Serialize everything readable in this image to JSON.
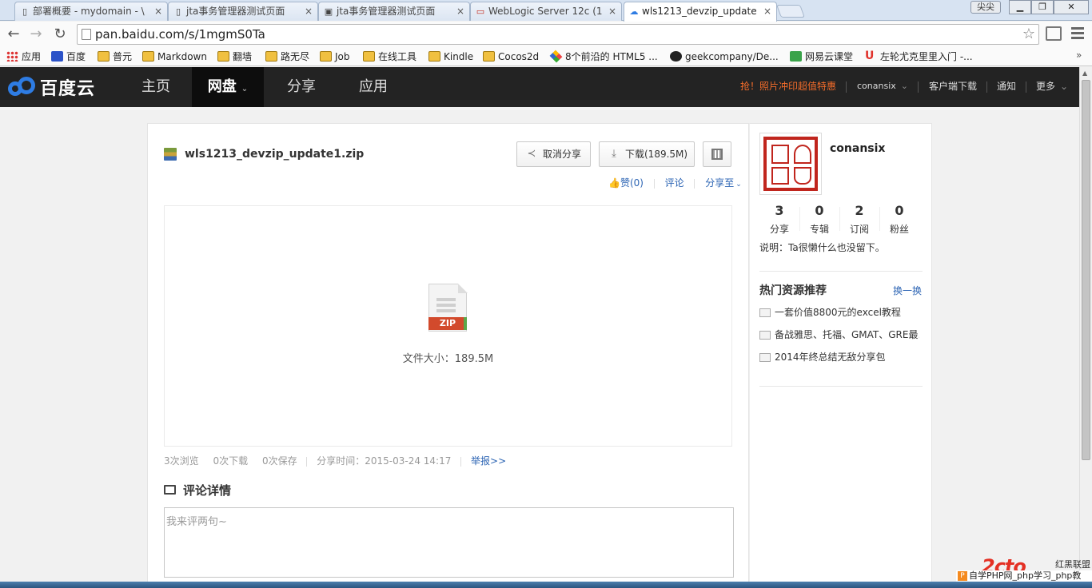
{
  "browser": {
    "tabs": [
      {
        "title": "部署概要 - mydomain - \\",
        "icon": "page-icon"
      },
      {
        "title": "jta事务管理器测试页面",
        "icon": "page-icon"
      },
      {
        "title": "jta事务管理器测试页面",
        "icon": "image-icon"
      },
      {
        "title": "WebLogic Server 12c (1",
        "icon": "oracle-icon"
      },
      {
        "title": "wls1213_devzip_update",
        "icon": "baidu-icon"
      }
    ],
    "user_button": "尖尖",
    "url": "pan.baidu.com/s/1mgmS0Ta",
    "bookmarks": [
      "应用",
      "百度",
      "普元",
      "Markdown",
      "翻墙",
      "路无尽",
      "Job",
      "在线工具",
      "Kindle",
      "Cocos2d",
      "8个前沿的 HTML5 ...",
      "geekcompany/De...",
      "网易云课堂",
      "左轮尤克里里入门 -..."
    ],
    "bookmarks_more": "»"
  },
  "header": {
    "logo_text": "百度云",
    "nav": [
      "主页",
      "网盘",
      "分享",
      "应用"
    ],
    "promo": "抢！照片冲印超值特惠",
    "user": "conansix",
    "client_download": "客户端下载",
    "notify": "通知",
    "more": "更多"
  },
  "file": {
    "name": "wls1213_devzip_update1.zip",
    "cancel_share": "取消分享",
    "download": "下载(189.5M)",
    "like": "赞(0)",
    "comment": "评论",
    "share_to": "分享至",
    "preview_tag": "ZIP",
    "size_label": "文件大小：189.5M",
    "views": "3次浏览",
    "downloads": "0次下载",
    "saves": "0次保存",
    "share_time": "分享时间：2015-03-24 14:17",
    "report": "举报>>"
  },
  "comments": {
    "title": "评论详情",
    "placeholder": "我来评两句~"
  },
  "sidebar": {
    "username": "conansix",
    "stats": [
      {
        "num": "3",
        "label": "分享"
      },
      {
        "num": "0",
        "label": "专辑"
      },
      {
        "num": "2",
        "label": "订阅"
      },
      {
        "num": "0",
        "label": "粉丝"
      }
    ],
    "description": "说明：Ta很懒什么也没留下。",
    "hot_title": "热门资源推荐",
    "hot_refresh": "换一换",
    "hot_items": [
      "一套价值8800元的excel教程",
      "备战雅思、托福、GMAT、GRE最…",
      "2014年终总结无敌分享包"
    ]
  },
  "watermark": {
    "logo": "2cto",
    "sub": "红黑联盟",
    "bar": "自学PHP网_php学习_php教"
  },
  "colors": {
    "header_bg": "#232323",
    "promo": "#f46c2a",
    "link": "#2d65b4",
    "zip_tag": "#d24a2c",
    "seal": "#c0251d"
  }
}
